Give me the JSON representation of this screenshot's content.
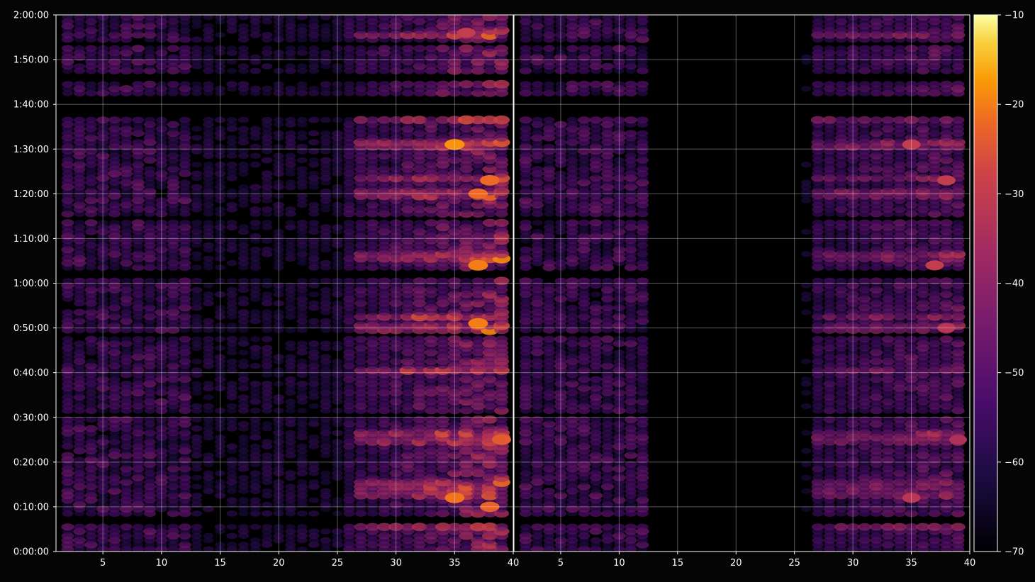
{
  "chart_data": {
    "type": "heatmap",
    "title": "",
    "panels": [
      {
        "name": "",
        "xlabel": "",
        "ylabel": "",
        "xlim": [
          1,
          40
        ],
        "ylim_seconds": [
          0,
          7200
        ],
        "x_ticks": [
          5,
          10,
          15,
          20,
          25,
          30,
          35,
          40
        ],
        "x_tick_labels": [
          "5",
          "10",
          "15",
          "20",
          "25",
          "30",
          "35",
          "40"
        ],
        "y_tick_labels": [
          "0:00:00",
          "0:10:00",
          "0:20:00",
          "0:30:00",
          "0:40:00",
          "0:50:00",
          "1:00:00",
          "1:10:00",
          "1:20:00",
          "1:30:00",
          "1:40:00",
          "1:50:00",
          "2:00:00"
        ],
        "grid": true,
        "hot_spots": [
          {
            "x": 35,
            "time": "1:31:00",
            "value": -18
          },
          {
            "x": 37,
            "time": "1:20:00",
            "value": -22
          },
          {
            "x": 38,
            "time": "1:23:00",
            "value": -22
          },
          {
            "x": 37,
            "time": "1:04:00",
            "value": -20
          },
          {
            "x": 37,
            "time": "0:51:00",
            "value": -20
          },
          {
            "x": 39,
            "time": "0:25:00",
            "value": -24
          },
          {
            "x": 35,
            "time": "0:12:00",
            "value": -21
          },
          {
            "x": 38,
            "time": "0:10:00",
            "value": -23
          },
          {
            "x": 36,
            "time": "1:56:00",
            "value": -30
          }
        ]
      },
      {
        "name": "",
        "xlabel": "",
        "ylabel": "",
        "xlim": [
          1,
          40
        ],
        "ylim_seconds": [
          0,
          7200
        ],
        "x_ticks": [
          5,
          10,
          15,
          20,
          25,
          30,
          35,
          40
        ],
        "x_tick_labels": [
          "5",
          "10",
          "15",
          "20",
          "25",
          "30",
          "35",
          "40"
        ],
        "grid": true,
        "hot_spots": [
          {
            "x": 35,
            "time": "1:31:00",
            "value": -30
          },
          {
            "x": 38,
            "time": "1:23:00",
            "value": -30
          },
          {
            "x": 37,
            "time": "1:04:00",
            "value": -30
          },
          {
            "x": 38,
            "time": "0:50:00",
            "value": -32
          },
          {
            "x": 39,
            "time": "0:25:00",
            "value": -34
          },
          {
            "x": 35,
            "time": "0:12:00",
            "value": -32
          }
        ]
      }
    ],
    "colorbar": {
      "colormap": "inferno",
      "range": [
        -70,
        -10
      ],
      "ticks": [
        -10,
        -20,
        -30,
        -40,
        -50,
        -60,
        -70
      ],
      "tick_labels": [
        "−10",
        "−20",
        "−30",
        "−40",
        "−50",
        "−60",
        "−70"
      ]
    }
  }
}
